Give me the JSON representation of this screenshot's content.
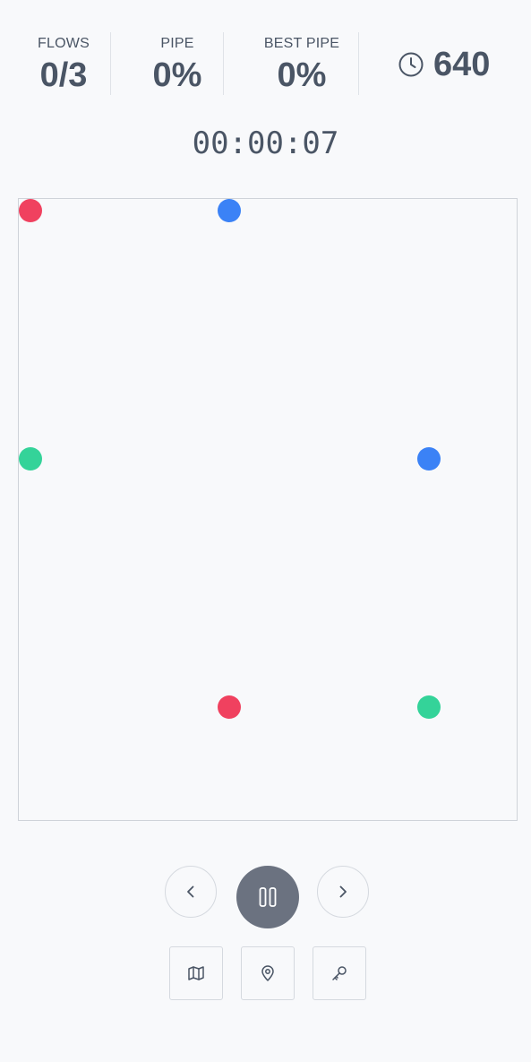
{
  "stats": {
    "flows": {
      "label": "FLOWS",
      "value": "0/3"
    },
    "pipe": {
      "label": "PIPE",
      "value": "0%"
    },
    "best_pipe": {
      "label": "BEST PIPE",
      "value": "0%"
    },
    "score": {
      "icon": "clock-icon",
      "value": "640"
    }
  },
  "timer": "00:00:07",
  "board": {
    "colors": {
      "red": "#f0415f",
      "blue": "#3b82f6",
      "green": "#34d399"
    },
    "dots": [
      {
        "color": "red",
        "pair": 1
      },
      {
        "color": "blue",
        "pair": 2
      },
      {
        "color": "green",
        "pair": 3
      },
      {
        "color": "blue",
        "pair": 2
      },
      {
        "color": "red",
        "pair": 1
      },
      {
        "color": "green",
        "pair": 3
      }
    ]
  },
  "controls": {
    "prev_icon": "chevron-left-icon",
    "pause_icon": "pause-icon",
    "next_icon": "chevron-right-icon"
  },
  "tools": {
    "map_icon": "map-icon",
    "pin_icon": "map-pin-icon",
    "key_icon": "key-icon"
  },
  "colors": {
    "text": "#4a5565",
    "background": "#f8f9fb",
    "border": "#cfd3d9",
    "pause_button": "#6b7280"
  }
}
